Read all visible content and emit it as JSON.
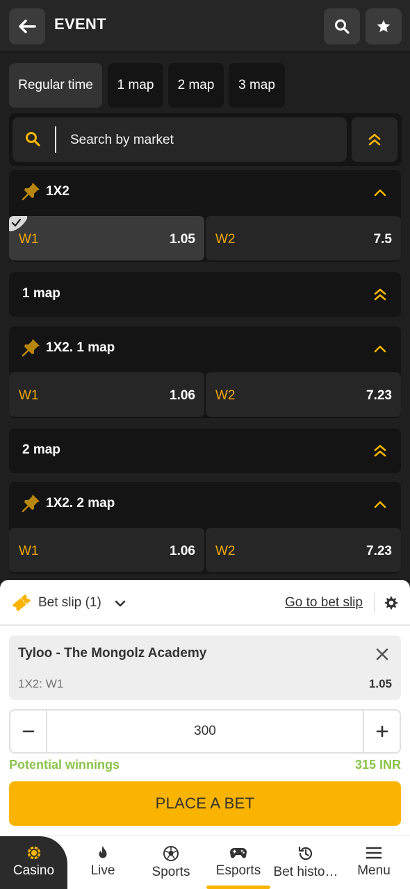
{
  "header": {
    "title": "EVENT",
    "back_icon": "arrow-left-icon",
    "search_icon": "search-icon",
    "favorite_icon": "star-icon"
  },
  "tabs": [
    {
      "label": "Regular time",
      "active": true
    },
    {
      "label": "1 map",
      "active": false
    },
    {
      "label": "2 map",
      "active": false
    },
    {
      "label": "3 map",
      "active": false
    }
  ],
  "search": {
    "placeholder": "Search by market"
  },
  "markets": [
    {
      "title": "1X2",
      "pinned": true,
      "expanded": true,
      "outcomes": [
        {
          "label": "W1",
          "odd": "1.05",
          "selected": true
        },
        {
          "label": "W2",
          "odd": "7.5",
          "selected": false
        }
      ]
    },
    {
      "title": "1 map",
      "pinned": false,
      "expanded": false
    },
    {
      "title": "1X2. 1 map",
      "pinned": true,
      "expanded": true,
      "outcomes": [
        {
          "label": "W1",
          "odd": "1.06",
          "selected": false
        },
        {
          "label": "W2",
          "odd": "7.23",
          "selected": false
        }
      ]
    },
    {
      "title": "2 map",
      "pinned": false,
      "expanded": false
    },
    {
      "title": "1X2. 2 map",
      "pinned": true,
      "expanded": true,
      "outcomes": [
        {
          "label": "W1",
          "odd": "1.06",
          "selected": false
        },
        {
          "label": "W2",
          "odd": "7.23",
          "selected": false
        }
      ]
    }
  ],
  "bet_slip": {
    "title": "Bet slip (1)",
    "go_to_label": "Go to bet slip",
    "bet": {
      "match": "Tyloo - The Mongolz Academy",
      "market": "1X2: W1",
      "odd": "1.05"
    },
    "stake": "300",
    "potential_label": "Potential winnings",
    "potential_value": "315 INR",
    "place_bet_label": "PLACE A BET"
  },
  "bottom_nav": [
    {
      "label": "Casino",
      "icon": "casino-chip-icon",
      "active": false
    },
    {
      "label": "Live",
      "icon": "flame-icon",
      "active": false
    },
    {
      "label": "Sports",
      "icon": "soccer-ball-icon",
      "active": false
    },
    {
      "label": "Esports",
      "icon": "gamepad-icon",
      "active": true
    },
    {
      "label": "Bet histo…",
      "icon": "history-icon",
      "active": false
    },
    {
      "label": "Menu",
      "icon": "hamburger-menu-icon",
      "active": false
    }
  ],
  "colors": {
    "accent": "#fab400",
    "odd_label": "#f5a800",
    "winnings": "#8bc34a",
    "background": "#1f1f1f",
    "card": "#141414"
  }
}
